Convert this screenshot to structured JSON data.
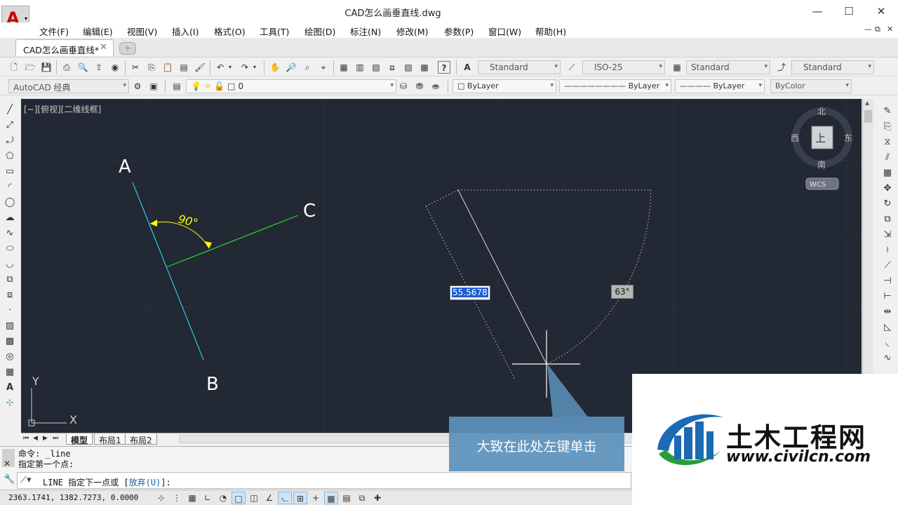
{
  "window": {
    "title": "CAD怎么画垂直线.dwg",
    "app_logo": "A",
    "controls": [
      "—",
      "☐",
      "✕"
    ]
  },
  "menubar": {
    "items": [
      "文件(F)",
      "编辑(E)",
      "视图(V)",
      "插入(I)",
      "格式(O)",
      "工具(T)",
      "绘图(D)",
      "标注(N)",
      "修改(M)",
      "参数(P)",
      "窗口(W)",
      "帮助(H)"
    ],
    "mdi_controls": [
      "—",
      "⧉",
      "✕"
    ]
  },
  "tabs": {
    "active": "CAD怎么画垂直线*",
    "new_tab_icon": "+"
  },
  "toolbar": {
    "text_style": "Standard",
    "dim_style": "ISO-25",
    "table_style": "Standard",
    "mleader_style": "Standard",
    "workspace": "AutoCAD 经典",
    "layer": "0",
    "color": "ByLayer",
    "linetype": "ByLayer",
    "lineweight": "ByLayer",
    "plotstyle": "ByColor"
  },
  "viewport": {
    "label": "[−][俯视][二维线框]",
    "point_a": "A",
    "point_b": "B",
    "point_c": "C",
    "angle_label": "90°",
    "dyn_length": "55.5678",
    "dyn_angle": "63°",
    "ucs_x": "X",
    "ucs_y": "Y"
  },
  "viewcube": {
    "north": "北",
    "south": "南",
    "east": "东",
    "west": "西",
    "face": "上",
    "wcs": "WCS"
  },
  "layout_tabs": [
    "模型",
    "布局1",
    "布局2"
  ],
  "command": {
    "history": [
      "命令: _line",
      "指定第一个点:"
    ],
    "current_cmd": "LINE",
    "prompt": "指定下一点或 [",
    "option": "放弃(U)",
    "prompt_end": "]:"
  },
  "status": {
    "coordinates": "2363.1741, 1382.7273, 0.0000"
  },
  "overlay": {
    "tooltip": "大致在此处左键单击"
  },
  "watermark": {
    "brand": "土木工程网",
    "url": "www.civilcn.com"
  },
  "colors": {
    "viewport_bg": "#222834",
    "line_ab": "#2ec8e6",
    "line_c": "#2fd12f",
    "dimension": "#ffff00"
  }
}
